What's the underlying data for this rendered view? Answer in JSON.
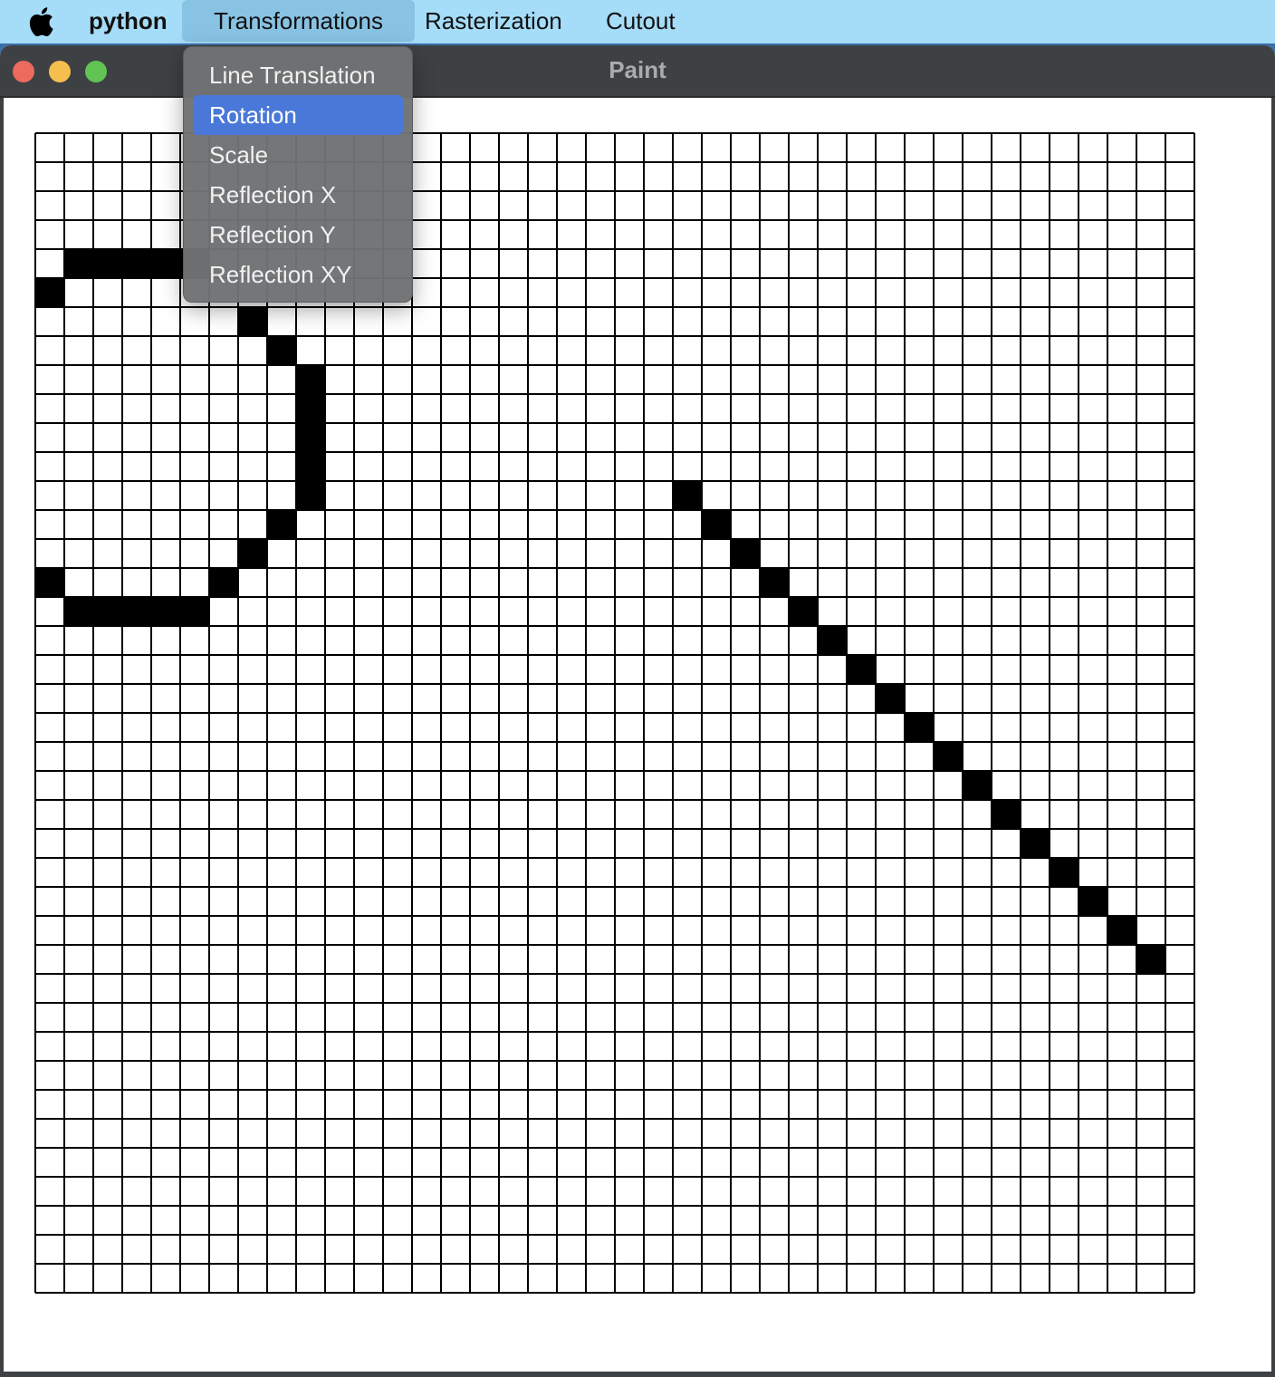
{
  "menubar": {
    "app_name": "python",
    "menus": [
      "Transformations",
      "Rasterization",
      "Cutout"
    ],
    "active_menu": "Transformations"
  },
  "window": {
    "title": "Paint"
  },
  "dropdown": {
    "items": [
      "Line Translation",
      "Rotation",
      "Scale",
      "Reflection X",
      "Reflection Y",
      "Reflection XY"
    ],
    "selected": "Rotation"
  },
  "canvas": {
    "columns": 40,
    "rows": 40,
    "filled_cells": [
      [
        1,
        4
      ],
      [
        2,
        4
      ],
      [
        3,
        4
      ],
      [
        4,
        4
      ],
      [
        5,
        4
      ],
      [
        0,
        5
      ],
      [
        7,
        6
      ],
      [
        8,
        7
      ],
      [
        9,
        8
      ],
      [
        9,
        9
      ],
      [
        9,
        10
      ],
      [
        9,
        11
      ],
      [
        9,
        12
      ],
      [
        8,
        13
      ],
      [
        7,
        14
      ],
      [
        0,
        15
      ],
      [
        6,
        15
      ],
      [
        1,
        16
      ],
      [
        2,
        16
      ],
      [
        3,
        16
      ],
      [
        4,
        16
      ],
      [
        5,
        16
      ],
      [
        22,
        12
      ],
      [
        23,
        13
      ],
      [
        24,
        14
      ],
      [
        25,
        15
      ],
      [
        26,
        16
      ],
      [
        27,
        17
      ],
      [
        28,
        18
      ],
      [
        29,
        19
      ],
      [
        30,
        20
      ],
      [
        31,
        21
      ],
      [
        32,
        22
      ],
      [
        33,
        23
      ],
      [
        34,
        24
      ],
      [
        35,
        25
      ],
      [
        36,
        26
      ],
      [
        37,
        27
      ],
      [
        38,
        28
      ]
    ],
    "colors": {
      "cell_fill": "#000000",
      "grid_line": "#000000",
      "background": "#ffffff"
    }
  }
}
